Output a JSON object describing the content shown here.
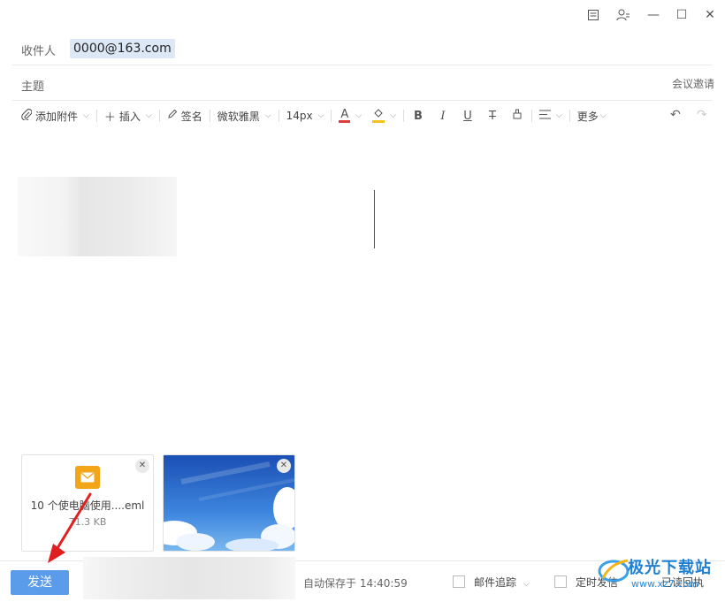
{
  "window_controls": {
    "minimize": "—",
    "maximize": "☐",
    "close": "✕"
  },
  "recipient": {
    "label": "收件人",
    "chip": "0000@163.com"
  },
  "subject": {
    "label": "主题",
    "meeting_invite": "会议邀请"
  },
  "toolbar": {
    "attach": "添加附件",
    "insert": "插入",
    "signature": "签名",
    "font_family": "微软雅黑",
    "font_size": "14px",
    "more": "更多",
    "font_color_hex": "#e03b3b",
    "highlight_color_hex": "#f3c21b"
  },
  "attachments": [
    {
      "name": "10 个使电脑使用....eml",
      "size": "71.3 KB",
      "icon": "mail-icon"
    },
    {
      "icon": "image-thumbnail"
    }
  ],
  "footer": {
    "send": "发送",
    "autosave": "自动保存于 14:40:59",
    "tracking": "邮件追踪",
    "scheduled": "定时发信",
    "receipt": "已读回执"
  },
  "watermark": {
    "text": "极光下载站",
    "url": "www.xz7.com"
  },
  "colors": {
    "send_button": "#5a9bea",
    "recipient_chip": "#dde8f6",
    "arrow": "#e02020"
  }
}
